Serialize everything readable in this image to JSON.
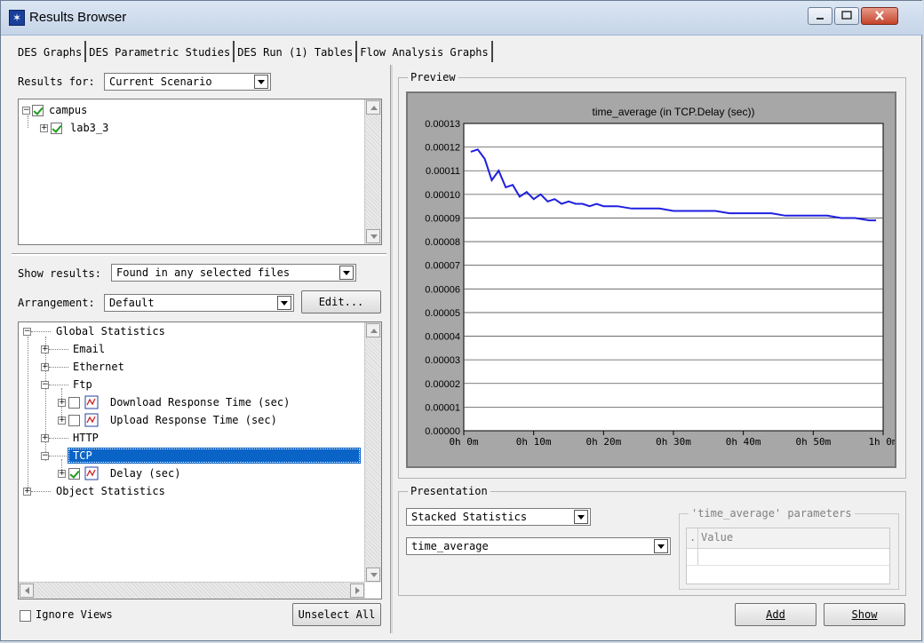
{
  "window": {
    "title": "Results Browser"
  },
  "tabs": [
    "DES Graphs",
    "DES Parametric Studies",
    "DES Run (1) Tables",
    "Flow Analysis Graphs"
  ],
  "left": {
    "results_for_label": "Results for:",
    "results_for_value": "Current Scenario",
    "scenario_tree": [
      {
        "label": "campus",
        "expander": "−",
        "checked": true
      },
      {
        "label": "lab3_3",
        "expander": "+",
        "checked": true
      }
    ],
    "show_results_label": "Show results:",
    "show_results_value": "Found in any selected files",
    "arrangement_label": "Arrangement:",
    "arrangement_value": "Default",
    "edit_button": "Edit...",
    "stats_tree": {
      "global": "Global Statistics",
      "email": "Email",
      "ethernet": "Ethernet",
      "ftp": "Ftp",
      "download": "Download Response Time (sec)",
      "upload": "Upload Response Time (sec)",
      "http": "HTTP",
      "tcp": "TCP",
      "delay": "Delay (sec)",
      "object": "Object Statistics"
    },
    "ignore_views_label": "Ignore Views",
    "unselect_all_button": "Unselect All"
  },
  "preview": {
    "group_label": "Preview"
  },
  "chart_data": {
    "type": "line",
    "title": "time_average (in TCP.Delay (sec))",
    "xlabel": "",
    "ylabel": "",
    "x_unit": "minutes",
    "xlim": [
      0,
      60
    ],
    "ylim": [
      0,
      0.00013
    ],
    "x_tick_labels": [
      "0h 0m",
      "0h 10m",
      "0h 20m",
      "0h 30m",
      "0h 40m",
      "0h 50m",
      "1h 0m"
    ],
    "y_tick_labels": [
      "0.00000",
      "0.00001",
      "0.00002",
      "0.00003",
      "0.00004",
      "0.00005",
      "0.00006",
      "0.00007",
      "0.00008",
      "0.00009",
      "0.00010",
      "0.00011",
      "0.00012",
      "0.00013"
    ],
    "grid": true,
    "series": [
      {
        "color": "#1f1fdf",
        "x": [
          1.0,
          2.0,
          3.0,
          4.0,
          5.0,
          6.0,
          7.0,
          8.0,
          9.0,
          10.0,
          11.0,
          12.0,
          13.0,
          14.0,
          15.0,
          16.0,
          17.0,
          18.0,
          19.0,
          20.0,
          22.0,
          24.0,
          26.0,
          28.0,
          30.0,
          32.0,
          34.0,
          36.0,
          38.0,
          40.0,
          42.0,
          44.0,
          46.0,
          48.0,
          50.0,
          52.0,
          54.0,
          56.0,
          58.0,
          59.0
        ],
        "y": [
          0.000118,
          0.000119,
          0.000115,
          0.000106,
          0.00011,
          0.000103,
          0.000104,
          9.9e-05,
          0.000101,
          9.8e-05,
          0.0001,
          9.7e-05,
          9.8e-05,
          9.6e-05,
          9.7e-05,
          9.6e-05,
          9.6e-05,
          9.5e-05,
          9.6e-05,
          9.5e-05,
          9.5e-05,
          9.4e-05,
          9.4e-05,
          9.4e-05,
          9.3e-05,
          9.3e-05,
          9.3e-05,
          9.3e-05,
          9.2e-05,
          9.2e-05,
          9.2e-05,
          9.2e-05,
          9.1e-05,
          9.1e-05,
          9.1e-05,
          9.1e-05,
          9e-05,
          9e-05,
          8.9e-05,
          8.9e-05
        ]
      }
    ]
  },
  "presentation": {
    "group_label": "Presentation",
    "stack_value": "Stacked Statistics",
    "filter_value": "time_average",
    "params_title": "'time_average' parameters",
    "params_col_dot": ".",
    "params_col_value": "Value"
  },
  "actions": {
    "add": "Add",
    "show": "Show"
  }
}
